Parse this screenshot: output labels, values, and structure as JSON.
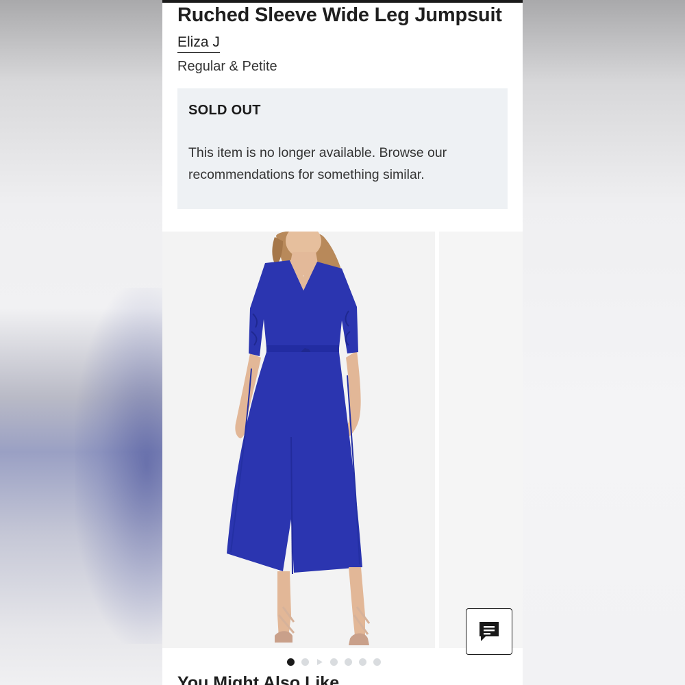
{
  "product": {
    "title": "Ruched Sleeve Wide Leg Jumpsuit",
    "brand": "Eliza J",
    "fit": "Regular & Petite"
  },
  "availability": {
    "status": "SOLD OUT",
    "message": "This item is no longer available. Browse our recommendations for something similar."
  },
  "gallery": {
    "image_count": 7,
    "active_index": 0,
    "video_index": 2,
    "garment_color": "#2b35b0"
  },
  "chat": {
    "icon": "chat-bubble-icon"
  },
  "recommendations": {
    "heading": "You Might Also Like"
  },
  "colors": {
    "notice_background": "#eef1f4",
    "text": "#1a1a1a",
    "dot_inactive": "#d9dcdf",
    "dot_active": "#1a1a1a"
  }
}
